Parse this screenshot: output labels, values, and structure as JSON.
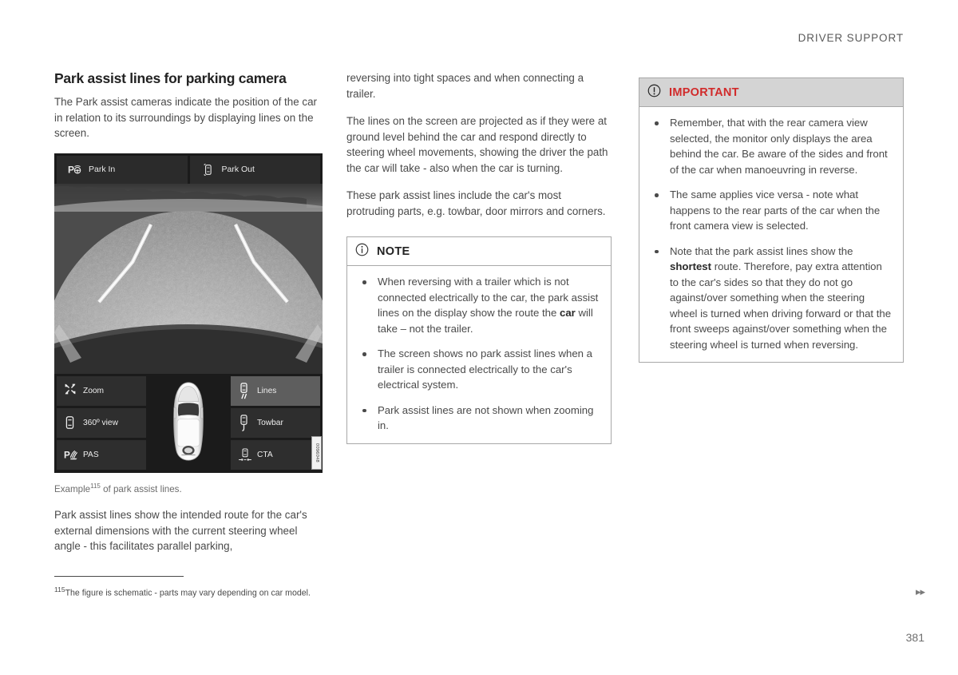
{
  "header": {
    "running_title": "DRIVER SUPPORT"
  },
  "footer": {
    "page_number": "381",
    "next_arrows": "▸▸"
  },
  "left_column": {
    "title": "Park assist lines for parking camera",
    "intro": "The Park assist cameras indicate the position of the car in relation to its surroundings by displaying lines on the screen.",
    "figure": {
      "caption_before": "Example",
      "caption_marker": "115",
      "caption_after": " of park assist lines.",
      "figure_code": "0096048",
      "camera_ui": {
        "top_buttons": [
          {
            "label": "Park In",
            "icon": "park-in-icon",
            "selected": false
          },
          {
            "label": "Park Out",
            "icon": "park-out-icon",
            "selected": false
          }
        ],
        "left_controls": [
          {
            "label": "Zoom",
            "icon": "zoom-arrows-icon",
            "selected": false
          },
          {
            "label": "360º view",
            "icon": "car-360-icon",
            "selected": false
          },
          {
            "label": "PAS",
            "icon": "pas-icon",
            "selected": false
          }
        ],
        "right_controls": [
          {
            "label": "Lines",
            "icon": "park-lines-icon",
            "selected": true
          },
          {
            "label": "Towbar",
            "icon": "towbar-icon",
            "selected": false
          },
          {
            "label": "CTA",
            "icon": "cta-icon",
            "selected": false
          }
        ],
        "center_graphic": "top-down-car-icon"
      }
    },
    "after_figure": "Park assist lines show the intended route for the car's external dimensions with the current steering wheel angle - this facilitates parallel parking,"
  },
  "middle_column": {
    "paragraphs": [
      "reversing into tight spaces and when connecting a trailer.",
      "The lines on the screen are projected as if they were at ground level behind the car and respond directly to steering wheel movements, showing the driver the path the car will take - also when the car is turning.",
      "These park assist lines include the car's most protruding parts, e.g. towbar, door mirrors and corners."
    ],
    "note_box": {
      "title": "NOTE",
      "icon": "info-circle-icon",
      "bullets": [
        {
          "text_before": "When reversing with a trailer which is not connected electrically to the car, the park assist lines on the display show the route the ",
          "bold": "car",
          "text_after": " will take – not the trailer."
        },
        {
          "text_before": "The screen shows no park assist lines when a trailer is connected electrically to the car's electrical system.",
          "bold": "",
          "text_after": ""
        },
        {
          "text_before": "Park assist lines are not shown when zooming in.",
          "bold": "",
          "text_after": ""
        }
      ]
    }
  },
  "right_column": {
    "important_box": {
      "title": "IMPORTANT",
      "icon": "exclamation-circle-icon",
      "title_color": "#d12b2b",
      "header_background": "#d4d4d4",
      "bullets": [
        {
          "text_before": "Remember, that with the rear camera view selected, the monitor only displays the area behind the car. Be aware of the sides and front of the car when manoeuvring in reverse.",
          "bold": "",
          "text_after": ""
        },
        {
          "text_before": "The same applies vice versa - note what happens to the rear parts of the car when the front camera view is selected.",
          "bold": "",
          "text_after": ""
        },
        {
          "text_before": "Note that the park assist lines show the ",
          "bold": "shortest",
          "text_after": " route. Therefore, pay extra attention to the car's sides so that they do not go against/over something when the steering wheel is turned when driving forward or that the front sweeps against/over something when the steering wheel is turned when reversing."
        }
      ]
    }
  },
  "footnote": {
    "marker": "115",
    "text": "The figure is schematic - parts may vary depending on car model."
  }
}
